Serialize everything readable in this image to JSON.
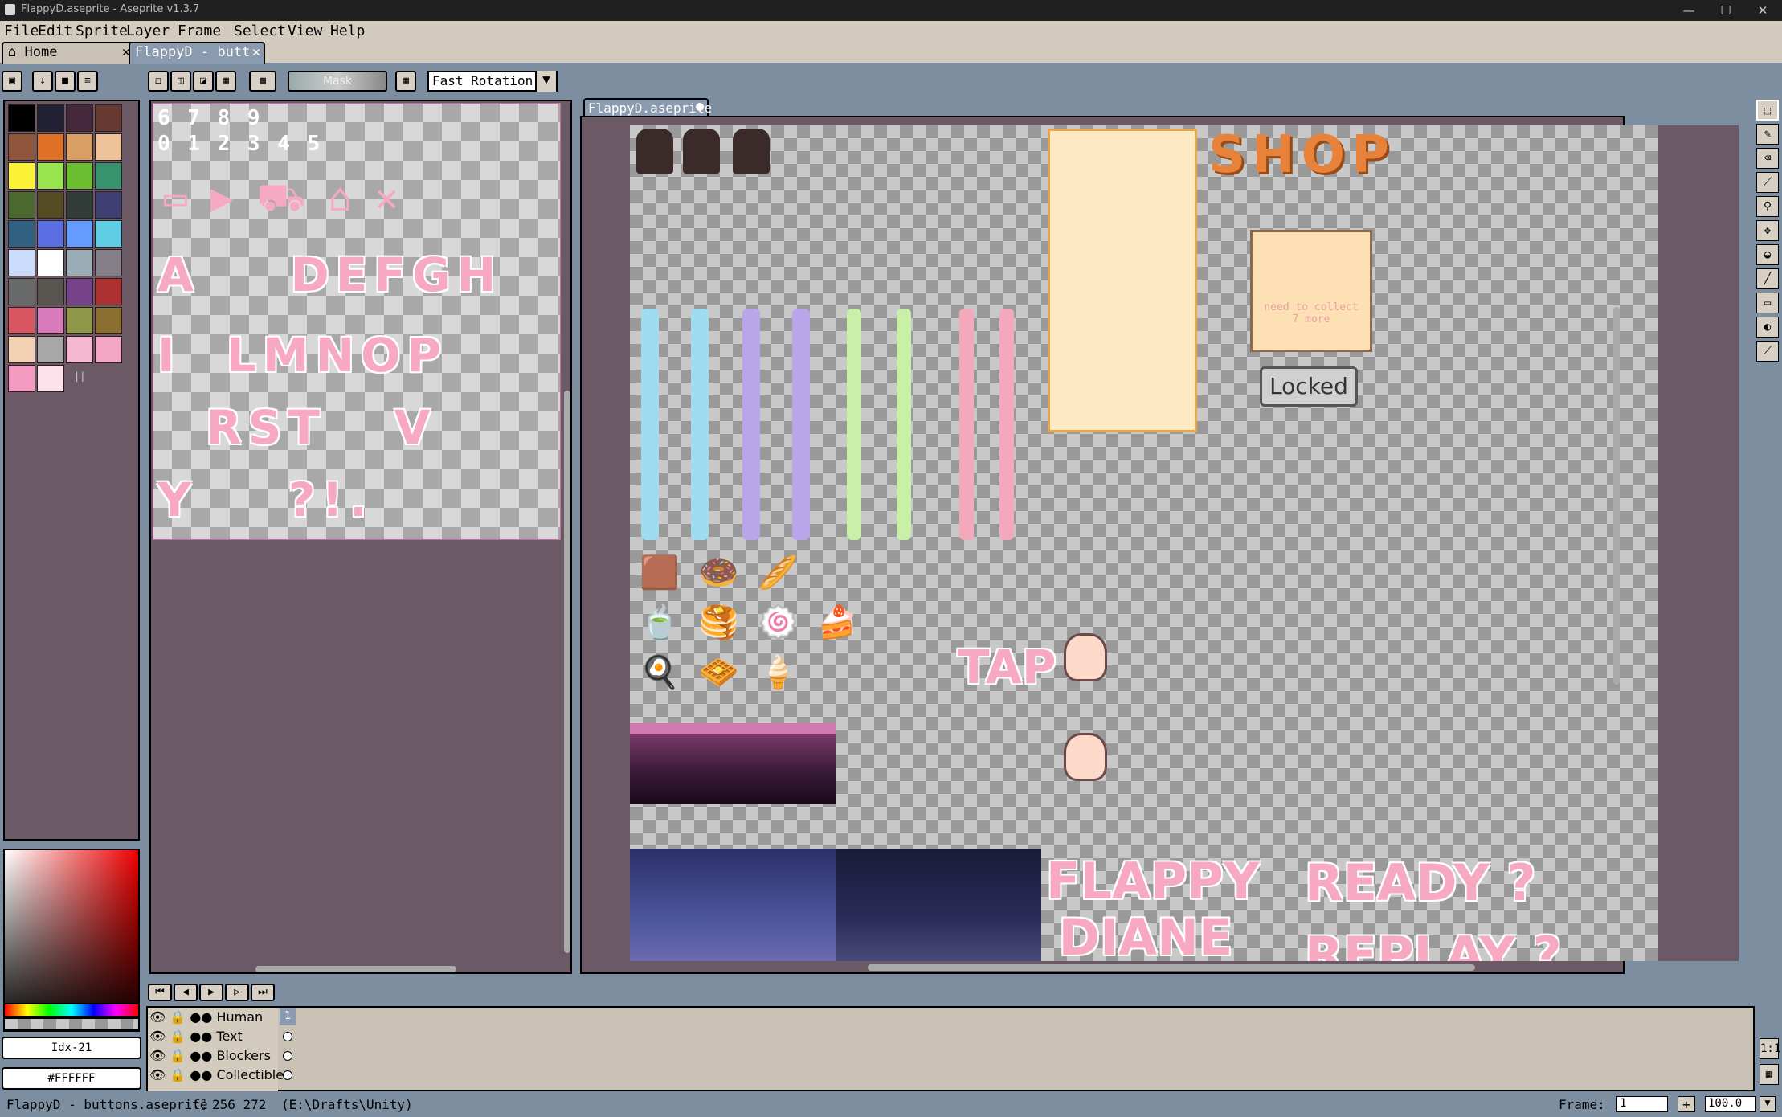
{
  "window": {
    "title": "FlappyD.aseprite - Aseprite v1.3.7",
    "minimize": "—",
    "maximize": "☐",
    "close": "✕"
  },
  "menu": [
    "File",
    "Edit",
    "Sprite",
    "Layer",
    "Frame",
    "Select",
    "View",
    "Help"
  ],
  "tabs": {
    "home": "Home",
    "doc": "FlappyD - butt",
    "close": "✕"
  },
  "toolbar": {
    "mask_label": "Mask",
    "rotation_value": "Fast Rotation"
  },
  "palette": {
    "swatches": [
      "#000000",
      "#222034",
      "#45283c",
      "#663931",
      "#8f563b",
      "#df7126",
      "#d9a066",
      "#eec39a",
      "#fbf236",
      "#99e550",
      "#6abe30",
      "#37946e",
      "#4b692f",
      "#524b24",
      "#323c39",
      "#3f3f74",
      "#306082",
      "#5b6ee1",
      "#639bff",
      "#5fcde4",
      "#cbdbfc",
      "#ffffff",
      "#9badb7",
      "#847e87",
      "#696a6a",
      "#595652",
      "#76428a",
      "#ac3232",
      "#d95763",
      "#d77bba",
      "#8f974a",
      "#8a6f30",
      "#f2d0b4",
      "#a8a8a8",
      "#f5b8cf",
      "#f3a6c3",
      "#f59ac0",
      "#fce0ea"
    ],
    "fg_index": "Idx-21",
    "hex_value": "#FFFFFF"
  },
  "editor": {
    "tab_label": "FlappyD.aseprite",
    "sprite_texts": {
      "shop": "SHOP",
      "locked": "Locked",
      "collect_note": "need to collect 7 more",
      "tap": "TAP",
      "flappy": "FLAPPY",
      "diane": "DIANE",
      "ready": "READY ?",
      "replay": "REPLAY ?"
    }
  },
  "font_sheet": {
    "digits_row1": "6 7 8 9",
    "digits_row2": "0 1 2 3 4 5",
    "letters_row1": "A    DEFGH",
    "letters_row2": "I  LMNOP",
    "letters_row3": "RST   V",
    "letters_row4": "Y    ?!."
  },
  "timeline": {
    "layers": [
      "Human",
      "Text",
      "Blockers",
      "Collectible"
    ],
    "frame_number": "1"
  },
  "status": {
    "file": "FlappyD - buttons.aseprite",
    "coords": "256 272",
    "path": "(E:\\Drafts\\Unity)",
    "frame_label": "Frame:",
    "frame_value": "1",
    "zoom_value": "100.0",
    "add_frame": "+"
  }
}
